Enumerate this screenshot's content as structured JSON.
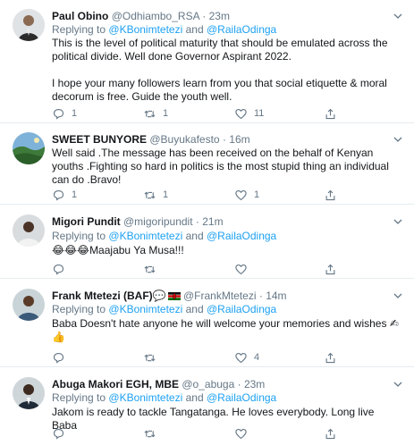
{
  "tweets": [
    {
      "name": "Paul Obino",
      "handle": "@Odhiambo_RSA",
      "dot": "·",
      "time": "23m",
      "reply_prefix": "Replying to",
      "mention_a": "@KBonimtetezi",
      "reply_and": "and",
      "mention_b": "@RailaOdinga",
      "text": "This is the level of political maturity that should be emulated across the political divide. Well done Governor Aspirant 2022.\n\nI hope your many followers learn from you that social etiquette & moral decorum is free. Guide the youth well.",
      "reply_count": "1",
      "retweet_count": "1",
      "like_count": "11"
    },
    {
      "name": "SWEET BUNYORE",
      "handle": "@Buyukafesto",
      "dot": "·",
      "time": "16m",
      "text": "Well said .The message has been received on the behalf of Kenyan youths .Fighting so hard in politics is the most stupid thing an individual can do .Bravo!",
      "reply_count": "1",
      "retweet_count": "1",
      "like_count": "1"
    },
    {
      "name": "Migori Pundit",
      "handle": "@migoripundit",
      "dot": "·",
      "time": "21m",
      "reply_prefix": "Replying to",
      "mention_a": "@KBonimtetezi",
      "reply_and": "and",
      "mention_b": "@RailaOdinga",
      "text": "😂😂😂Maajabu Ya Musa!!!",
      "reply_count": "",
      "retweet_count": "",
      "like_count": ""
    },
    {
      "name": "Frank Mtetezi (BAF)",
      "name_emoji": "💬",
      "handle": "@FrankMtetezi",
      "dot": "·",
      "time": "14m",
      "reply_prefix": "Replying to",
      "mention_a": "@KBonimtetezi",
      "reply_and": "and",
      "mention_b": "@RailaOdinga",
      "text": "Baba Doesn't hate  anyone he will welcome your memories and wishes ✍\n👍",
      "reply_count": "",
      "retweet_count": "",
      "like_count": "4"
    },
    {
      "name": "Abuga Makori EGH, MBE",
      "handle": "@o_abuga",
      "dot": "·",
      "time": "23m",
      "reply_prefix": "Replying to",
      "mention_a": "@KBonimtetezi",
      "reply_and": "and",
      "mention_b": "@RailaOdinga",
      "text": "Jakom is ready to tackle Tangatanga. He loves everybody. Long live Baba",
      "reply_count": "",
      "retweet_count": "",
      "like_count": ""
    }
  ],
  "colors": {
    "text": "#14171a",
    "muted": "#657786",
    "link": "#1da1f2",
    "border": "#e6ecf0"
  },
  "icons": [
    "reply-icon",
    "retweet-icon",
    "like-icon",
    "share-icon",
    "chevron-down-icon",
    "kenya-flag-icon"
  ]
}
